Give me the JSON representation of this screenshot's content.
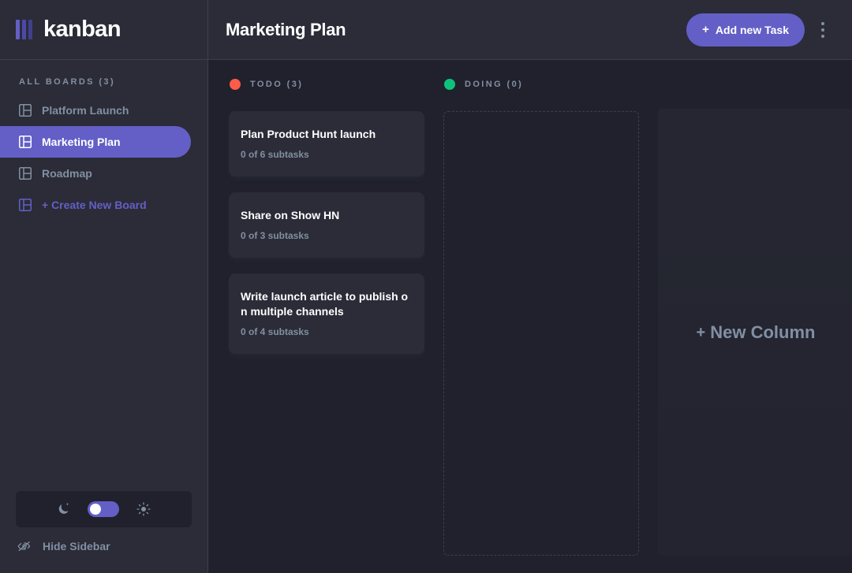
{
  "app": {
    "logo_text": "kanban"
  },
  "sidebar": {
    "boards_heading": "ALL BOARDS (3)",
    "items": [
      {
        "label": "Platform Launch",
        "icon": "board-icon",
        "active": false
      },
      {
        "label": "Marketing Plan",
        "icon": "board-icon",
        "active": true
      },
      {
        "label": "Roadmap",
        "icon": "board-icon",
        "active": false
      }
    ],
    "create_board_label": "+ Create New Board",
    "theme_toggle": {
      "dark_icon": "moon-icon",
      "light_icon": "sun-icon",
      "state": "dark"
    },
    "hide_sidebar_label": "Hide Sidebar",
    "hide_sidebar_icon": "eye-off-icon"
  },
  "header": {
    "title": "Marketing Plan",
    "add_task_label": "Add new Task",
    "add_task_plus": "+",
    "menu_icon": "kebab-menu-icon"
  },
  "board": {
    "columns": [
      {
        "name": "TODO (3)",
        "dot_color": "#ff5b49",
        "tasks": [
          {
            "title": "Plan Product Hunt launch",
            "subtasks": "0 of 6 subtasks"
          },
          {
            "title": "Share on Show HN",
            "subtasks": "0 of 3 subtasks"
          },
          {
            "title": "Write launch article to publish on multiple channels",
            "subtasks": "0 of 4 subtasks"
          }
        ]
      },
      {
        "name": "DOING (0)",
        "dot_color": "#0ec27c",
        "tasks": []
      }
    ],
    "new_column_label": "New Column",
    "new_column_plus": "+"
  },
  "colors": {
    "accent": "#635fc7",
    "sidebar_bg": "#2b2c37",
    "board_bg": "#20212c",
    "muted_text": "#828fa3",
    "border": "#3e3f4e"
  }
}
